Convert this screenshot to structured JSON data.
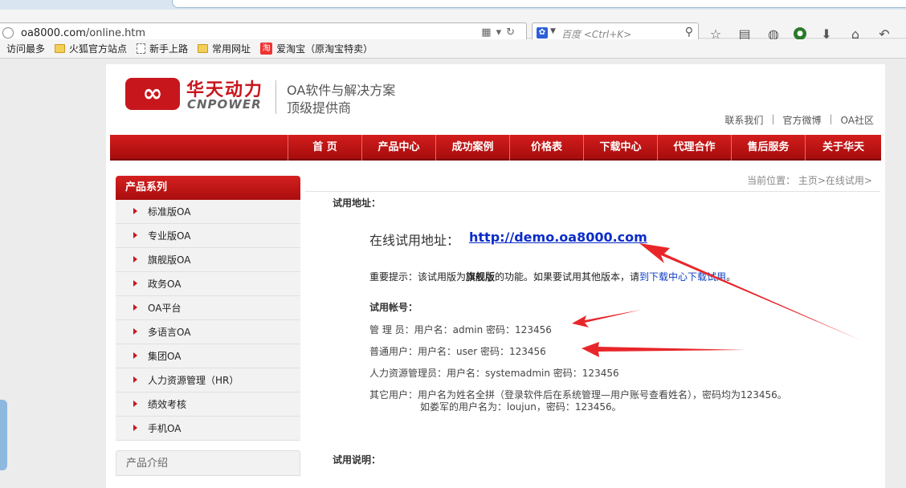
{
  "browser": {
    "url_host": "oa8000.com",
    "url_path": "/online.htm",
    "search_placeholder": "百度 <Ctrl+K>",
    "search_engine_icon": "baidu-paw-icon",
    "bookmarks": [
      {
        "label": "访问最多",
        "icon": "none"
      },
      {
        "label": "火狐官方站点",
        "icon": "folder-icon"
      },
      {
        "label": "新手上路",
        "icon": "page-icon"
      },
      {
        "label": "常用网址",
        "icon": "folder-icon"
      },
      {
        "label": "爱淘宝（原淘宝特卖）",
        "icon": "taobao-icon",
        "icon_text": "淘"
      }
    ]
  },
  "site": {
    "logo_cn": "华天动力",
    "logo_en": "CNPOWER",
    "slogan_line1": "OA软件与解决方案",
    "slogan_line2": "顶级提供商",
    "top_links": [
      "联系我们",
      "官方微博",
      "OA社区"
    ],
    "top_link_sep": "|",
    "nav": [
      "首 页",
      "产品中心",
      "成功案例",
      "价格表",
      "下载中心",
      "代理合作",
      "售后服务",
      "关于华天"
    ],
    "breadcrumb": "当前位置： 主页>在线试用>",
    "sidebar": {
      "title": "产品系列",
      "items": [
        "标准版OA",
        "专业版OA",
        "旗舰版OA",
        "政务OA",
        "OA平台",
        "多语言OA",
        "集团OA",
        "人力资源管理（HR）",
        "绩效考核",
        "手机OA"
      ],
      "second_title": "产品介绍"
    }
  },
  "content": {
    "trial_addr_title": "试用地址：",
    "trial_url_label": "在线试用地址：",
    "trial_url": "http://demo.oa8000.com",
    "notice_prefix": "重要提示：该试用版为",
    "notice_bold": "旗舰版",
    "notice_mid": "的功能。如果要试用其他版本，请",
    "notice_link": "到下载中心下载试用",
    "notice_end": "。",
    "account_title": "试用帐号：",
    "accounts": [
      "管 理 员：用户名：admin    密码：123456",
      "普通用户：用户名：user     密码：123456",
      "人力资源管理员：用户名：systemadmin     密码：123456",
      "其它用户：用户名为姓名全拼（登录软件后在系统管理—用户账号查看姓名），密码均为123456。",
      "如娄军的用户名为：loujun，密码：123456。"
    ],
    "usage_title": "试用说明："
  },
  "colors": {
    "brand_red": "#c8161d",
    "link_blue": "#0a2cc8",
    "arrow_red": "#e8262a"
  }
}
